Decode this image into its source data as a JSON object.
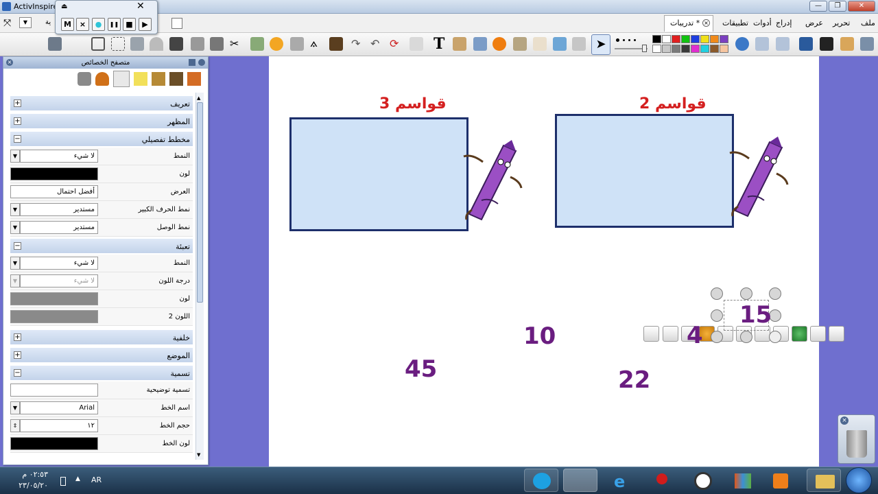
{
  "window": {
    "title": "ActivInspire"
  },
  "menu": {
    "items": [
      "ملف",
      "تحرير",
      "عرض",
      "إدراج",
      "أدوات",
      "تطبيقات"
    ]
  },
  "document_tab": {
    "label": "تدريبات *"
  },
  "left_menu_fragment": "ية",
  "recorder": {
    "buttons": [
      "M",
      "×",
      "●",
      "❚❚",
      "■",
      "▶"
    ]
  },
  "panel": {
    "title": "متصفح الخصائص",
    "sections": [
      {
        "label": "تعريف",
        "state": "+"
      },
      {
        "label": "المظهر",
        "state": "+"
      },
      {
        "label": "مخطط تفصيلي",
        "state": "−"
      },
      {
        "label": "تعبئة",
        "state": "−"
      },
      {
        "label": "خلفية",
        "state": "+"
      },
      {
        "label": "الموضع",
        "state": "+"
      },
      {
        "label": "تسمية",
        "state": "−"
      }
    ],
    "outline": [
      {
        "label": "النمط",
        "value": "لا شيء"
      },
      {
        "label": "لون",
        "value": ""
      },
      {
        "label": "العرض",
        "value": "أفضل احتمال"
      },
      {
        "label": "نمط الحرف الكبير",
        "value": "مستدير"
      },
      {
        "label": "نمط الوصل",
        "value": "مستدير"
      }
    ],
    "fill": [
      {
        "label": "النمط",
        "value": "لا شيء"
      },
      {
        "label": "درجة اللون",
        "value": "لا شيء"
      },
      {
        "label": "لون",
        "value": ""
      },
      {
        "label": "اللون 2",
        "value": ""
      }
    ],
    "label_section": [
      {
        "label": "تسمية توضيحية",
        "value": ""
      },
      {
        "label": "اسم الخط",
        "value": "Arial"
      },
      {
        "label": "حجم الخط",
        "value": "١٢"
      },
      {
        "label": "لون الخط",
        "value": ""
      }
    ]
  },
  "canvas": {
    "box_left_title": "قواسم 3",
    "box_right_title": "قواسم 2",
    "numbers": [
      "15",
      "4",
      "10",
      "45",
      "22"
    ]
  },
  "taskbar": {
    "language": "AR",
    "time": "٠٢:٥٣ م",
    "date": "٢٣/٠٥/٢٠"
  },
  "colors": {
    "canvas_bg": "#6f6fcf",
    "box_fill": "#cfe2f7",
    "box_border": "#1d2f6b",
    "number": "#6a1d80",
    "title": "#d42020"
  }
}
